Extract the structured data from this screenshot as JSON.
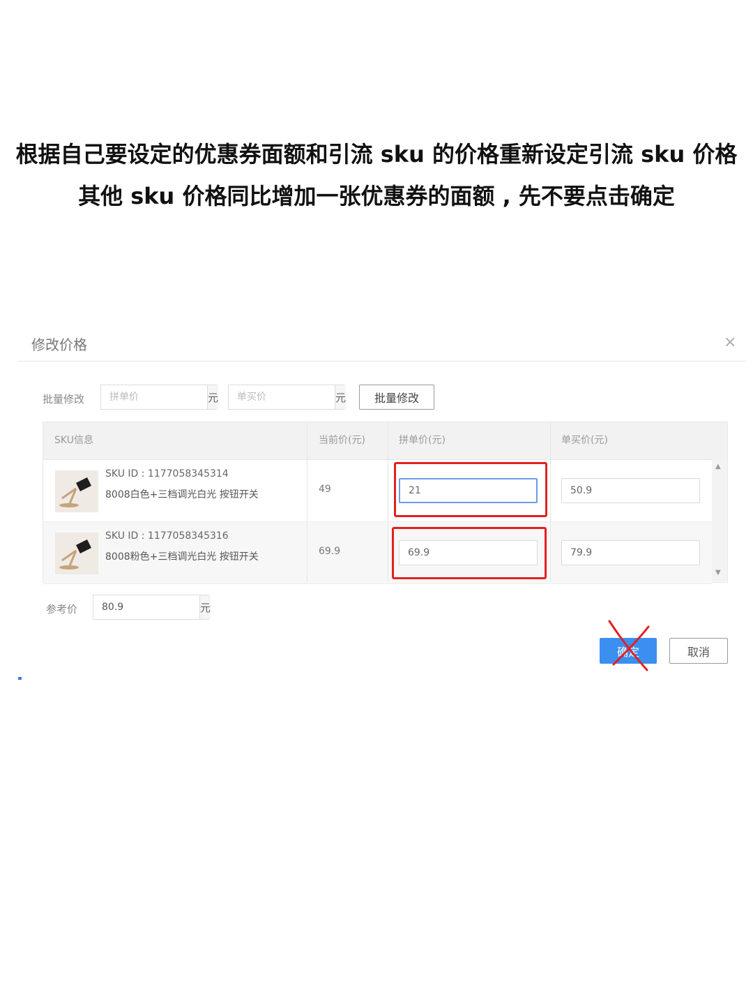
{
  "caption": {
    "line1": "根据自己要设定的优惠券面额和引流 sku 的价格重新设定引流 sku 价格",
    "line2": "其他 sku 价格同比增加一张优惠券的面额 , 先不要点击确定"
  },
  "dialog": {
    "title": "修改价格",
    "close_icon": "close-icon"
  },
  "batch": {
    "label": "批量修改",
    "group_price_placeholder": "拼单价",
    "single_price_placeholder": "单买价",
    "unit": "元",
    "button_label": "批量修改"
  },
  "table": {
    "headers": [
      "SKU信息",
      "当前价(元)",
      "拼单价(元)",
      "单买价(元)"
    ],
    "rows": [
      {
        "sku_id": "SKU ID : 1177058345314",
        "name": "8008白色+三档调光白光 按钮开关",
        "current_price": "49",
        "group_price": "21",
        "single_price": "50.9"
      },
      {
        "sku_id": "SKU ID : 1177058345316",
        "name": "8008粉色+三档调光白光 按钮开关",
        "current_price": "69.9",
        "group_price": "69.9",
        "single_price": "79.9"
      }
    ]
  },
  "reference": {
    "label": "参考价",
    "value": "80.9",
    "unit": "元"
  },
  "footer": {
    "confirm_label": "确定",
    "cancel_label": "取消"
  },
  "colors": {
    "primary": "#3b8ff0",
    "highlight": "#e32020"
  }
}
